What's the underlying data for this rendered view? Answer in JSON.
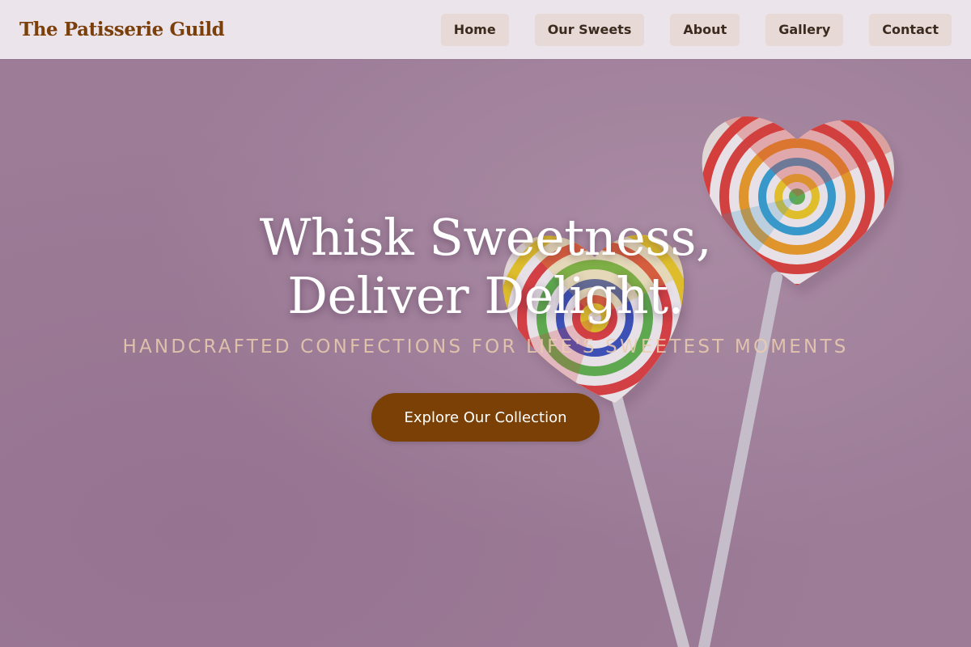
{
  "brand": {
    "name": "The Patisserie Guild"
  },
  "nav": {
    "items": [
      {
        "label": "Home"
      },
      {
        "label": "Our Sweets"
      },
      {
        "label": "About"
      },
      {
        "label": "Gallery"
      },
      {
        "label": "Contact"
      }
    ]
  },
  "hero": {
    "title_line1": "Whisk Sweetness,",
    "title_line2": "Deliver Delight.",
    "subtitle": "Handcrafted Confections for Life's Sweetest Moments",
    "cta_label": "Explore Our Collection"
  },
  "colors": {
    "brand": "#7a3f0a",
    "nav_button_bg": "#e6d9d6",
    "cta_bg": "#7a4006",
    "hero_bg": "#a4849e"
  }
}
